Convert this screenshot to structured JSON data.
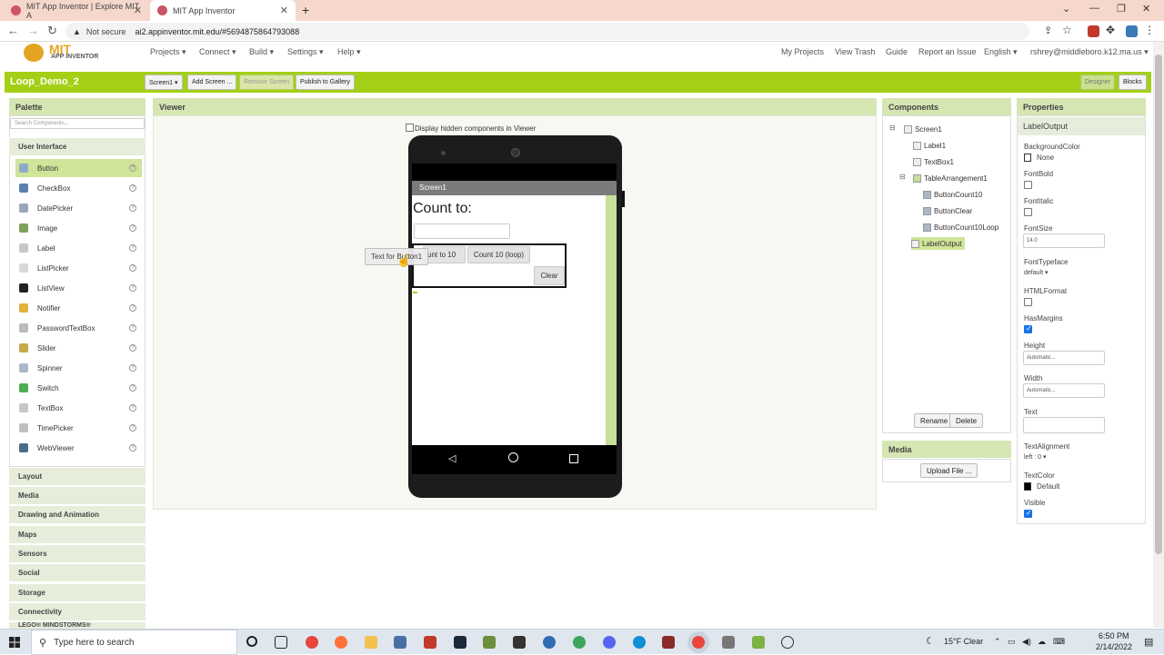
{
  "browser": {
    "tabs": [
      {
        "title": "MIT App Inventor | Explore MIT A",
        "active": false
      },
      {
        "title": "MIT App Inventor",
        "active": true
      }
    ],
    "new_tab": "+",
    "not_secure": "Not secure",
    "url": "ai2.appinventor.mit.edu/#5694875864793088"
  },
  "app_header": {
    "logo_text": "MIT",
    "logo_sub": "APP INVENTOR",
    "left_menus": [
      "Projects ▾",
      "Connect ▾",
      "Build ▾",
      "Settings ▾",
      "Help ▾"
    ],
    "right_menus": [
      "My Projects",
      "View Trash",
      "Guide",
      "Report an Issue",
      "English ▾",
      "rshrey@middleboro.k12.ma.us ▾"
    ]
  },
  "project_bar": {
    "name": "Loop_Demo_2",
    "screen_select": "Screen1 ▾",
    "add_screen": "Add Screen ...",
    "remove_screen": "Remove Screen",
    "publish": "Publish to Gallery",
    "designer": "Designer",
    "blocks": "Blocks"
  },
  "palette": {
    "header": "Palette",
    "search_placeholder": "Search Components...",
    "category_open": "User Interface",
    "items": [
      {
        "label": "Button",
        "icon": "button-icon",
        "color": "#8fa9c9"
      },
      {
        "label": "CheckBox",
        "icon": "checkbox-icon",
        "color": "#5b7fb0"
      },
      {
        "label": "DatePicker",
        "icon": "calendar-icon",
        "color": "#9aa7b8"
      },
      {
        "label": "Image",
        "icon": "image-icon",
        "color": "#7fa35a"
      },
      {
        "label": "Label",
        "icon": "label-icon",
        "color": "#c7c7c7"
      },
      {
        "label": "ListPicker",
        "icon": "list-picker-icon",
        "color": "#d8d8d8"
      },
      {
        "label": "ListView",
        "icon": "listview-icon",
        "color": "#222222"
      },
      {
        "label": "Notifier",
        "icon": "warning-icon",
        "color": "#e2b23a"
      },
      {
        "label": "PasswordTextBox",
        "icon": "password-icon",
        "color": "#bbbbbb"
      },
      {
        "label": "Slider",
        "icon": "slider-icon",
        "color": "#c9a84a"
      },
      {
        "label": "Spinner",
        "icon": "spinner-icon",
        "color": "#aab7c7"
      },
      {
        "label": "Switch",
        "icon": "switch-icon",
        "color": "#4caf50"
      },
      {
        "label": "TextBox",
        "icon": "textbox-icon",
        "color": "#c7c7c7"
      },
      {
        "label": "TimePicker",
        "icon": "clock-icon",
        "color": "#bfbfbf"
      },
      {
        "label": "WebViewer",
        "icon": "globe-icon",
        "color": "#4a6b8a"
      }
    ],
    "help_glyph": "?",
    "categories": [
      "Layout",
      "Media",
      "Drawing and Animation",
      "Maps",
      "Sensors",
      "Social",
      "Storage",
      "Connectivity",
      "LEGO® MINDSTORMS®"
    ]
  },
  "viewer": {
    "header": "Viewer",
    "hidden_label": "Display hidden components in Viewer",
    "status_time": "9:48",
    "screen_title": "Screen1",
    "label_text": "Count to:",
    "btn_count10": "Count to 10",
    "btn_count10_visible": "unt to 10",
    "btn_count10_loop": "Count 10 (loop)",
    "btn_clear": "Clear",
    "drag_ghost": "Text for Button1"
  },
  "components": {
    "header": "Components",
    "tree": [
      {
        "label": "Screen1",
        "level": 0,
        "toggle": "⊟"
      },
      {
        "label": "Label1",
        "level": 1
      },
      {
        "label": "TextBox1",
        "level": 1
      },
      {
        "label": "TableArrangement1",
        "level": 1,
        "toggle": "⊟"
      },
      {
        "label": "ButtonCount10",
        "level": 2
      },
      {
        "label": "ButtonClear",
        "level": 2
      },
      {
        "label": "ButtonCount10Loop",
        "level": 2
      },
      {
        "label": "LabelOutput",
        "level": 1,
        "selected": true
      }
    ],
    "rename": "Rename",
    "delete": "Delete"
  },
  "media": {
    "header": "Media",
    "upload": "Upload File ..."
  },
  "properties": {
    "header": "Properties",
    "component": "LabelOutput",
    "bg_color_label": "BackgroundColor",
    "bg_color_value": "None",
    "fontbold_label": "FontBold",
    "fontbold": false,
    "fontitalic_label": "FontItalic",
    "fontitalic": false,
    "fontsize_label": "FontSize",
    "fontsize_value": "14.0",
    "fonttypeface_label": "FontTypeface",
    "fonttypeface_value": "default ▾",
    "htmlformat_label": "HTMLFormat",
    "htmlformat": false,
    "hasmargins_label": "HasMargins",
    "hasmargins": true,
    "height_label": "Height",
    "height_value": "Automatic...",
    "width_label": "Width",
    "width_value": "Automatic...",
    "text_label": "Text",
    "text_value": "",
    "textalign_label": "TextAlignment",
    "textalign_value": "left : 0 ▾",
    "textcolor_label": "TextColor",
    "textcolor_value": "Default",
    "visible_label": "Visible",
    "visible": true
  },
  "taskbar": {
    "search_placeholder": "Type here to search",
    "weather": "15°F  Clear",
    "time": "6:50 PM",
    "date": "2/14/2022"
  },
  "colors": {
    "accent_green": "#a3d016",
    "panel_header": "#d5e6b3",
    "selected": "#d0e49a"
  }
}
